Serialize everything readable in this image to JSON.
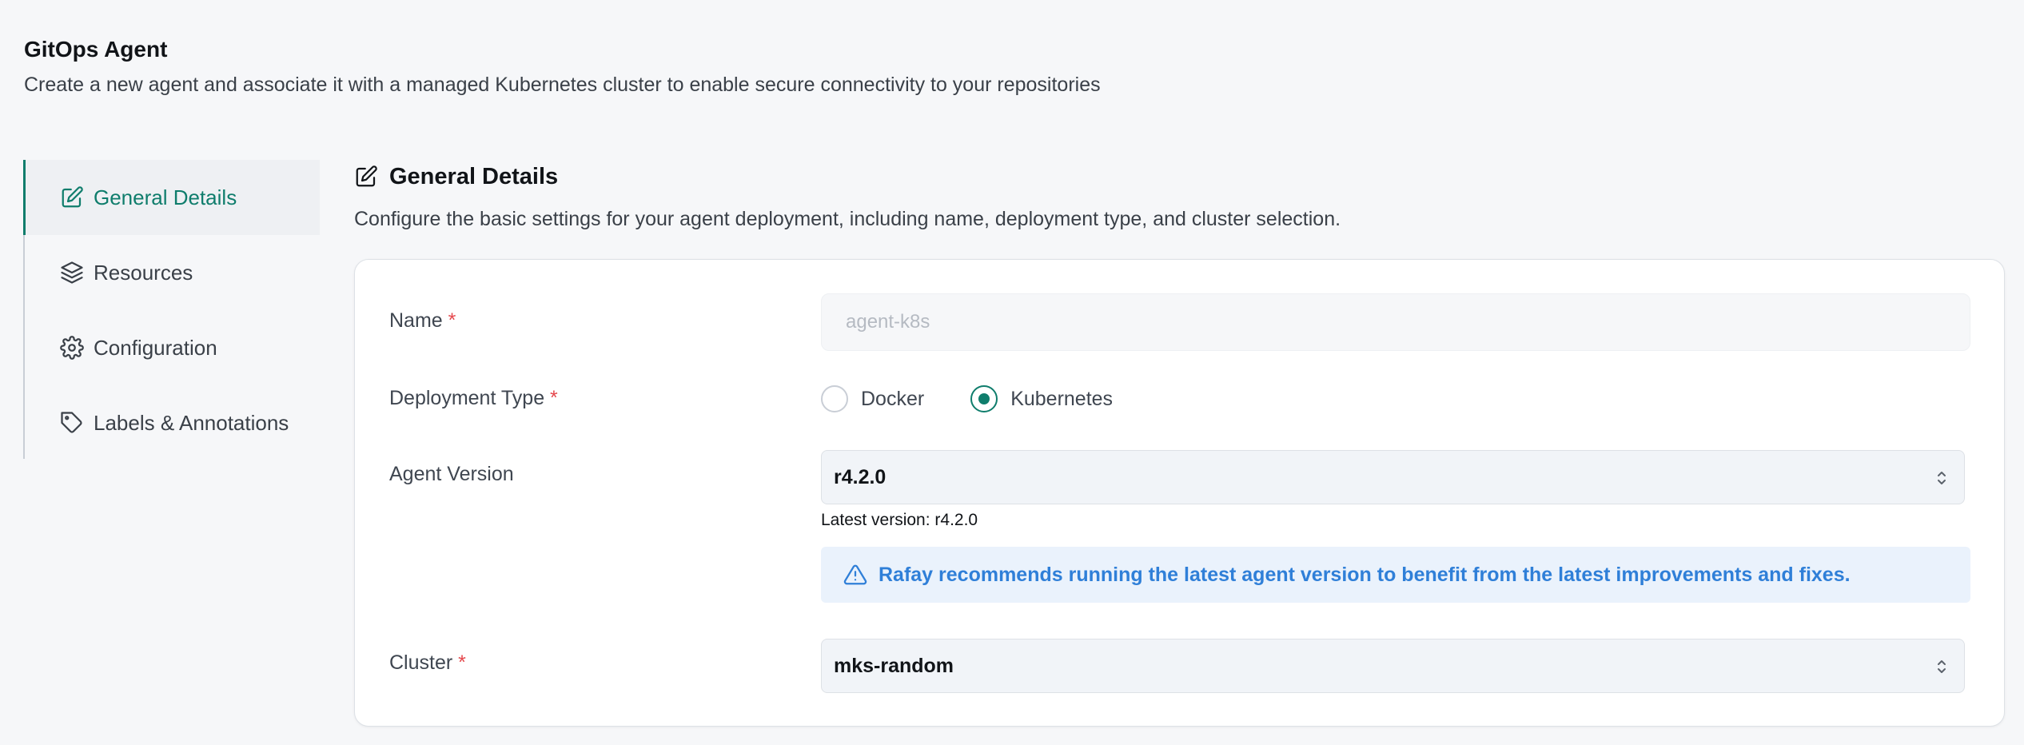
{
  "header": {
    "title": "GitOps Agent",
    "subtitle": "Create a new agent and associate it with a managed Kubernetes cluster to enable secure connectivity to your repositories"
  },
  "sidebar": {
    "items": [
      {
        "label": "General Details",
        "icon": "edit-icon",
        "active": true
      },
      {
        "label": "Resources",
        "icon": "layers-icon",
        "active": false
      },
      {
        "label": "Configuration",
        "icon": "gear-icon",
        "active": false
      },
      {
        "label": "Labels & Annotations",
        "icon": "tag-icon",
        "active": false
      }
    ]
  },
  "section": {
    "title": "General Details",
    "description": "Configure the basic settings for your agent deployment, including name, deployment type, and cluster selection."
  },
  "form": {
    "name": {
      "label": "Name",
      "required_mark": "*",
      "placeholder": "agent-k8s"
    },
    "deployment_type": {
      "label": "Deployment Type",
      "required_mark": "*",
      "options": [
        {
          "label": "Docker",
          "checked": false
        },
        {
          "label": "Kubernetes",
          "checked": true
        }
      ]
    },
    "agent_version": {
      "label": "Agent Version",
      "value": "r4.2.0",
      "latest_note": "Latest version: r4.2.0",
      "banner": "Rafay recommends running the latest agent version to benefit from the latest improvements and fixes."
    },
    "cluster": {
      "label": "Cluster",
      "required_mark": "*",
      "value": "mks-random"
    }
  },
  "colors": {
    "accent": "#0f7d6c",
    "required": "#e5484d",
    "info_text": "#2f7fd8",
    "info_bg": "#eaf2fc"
  }
}
